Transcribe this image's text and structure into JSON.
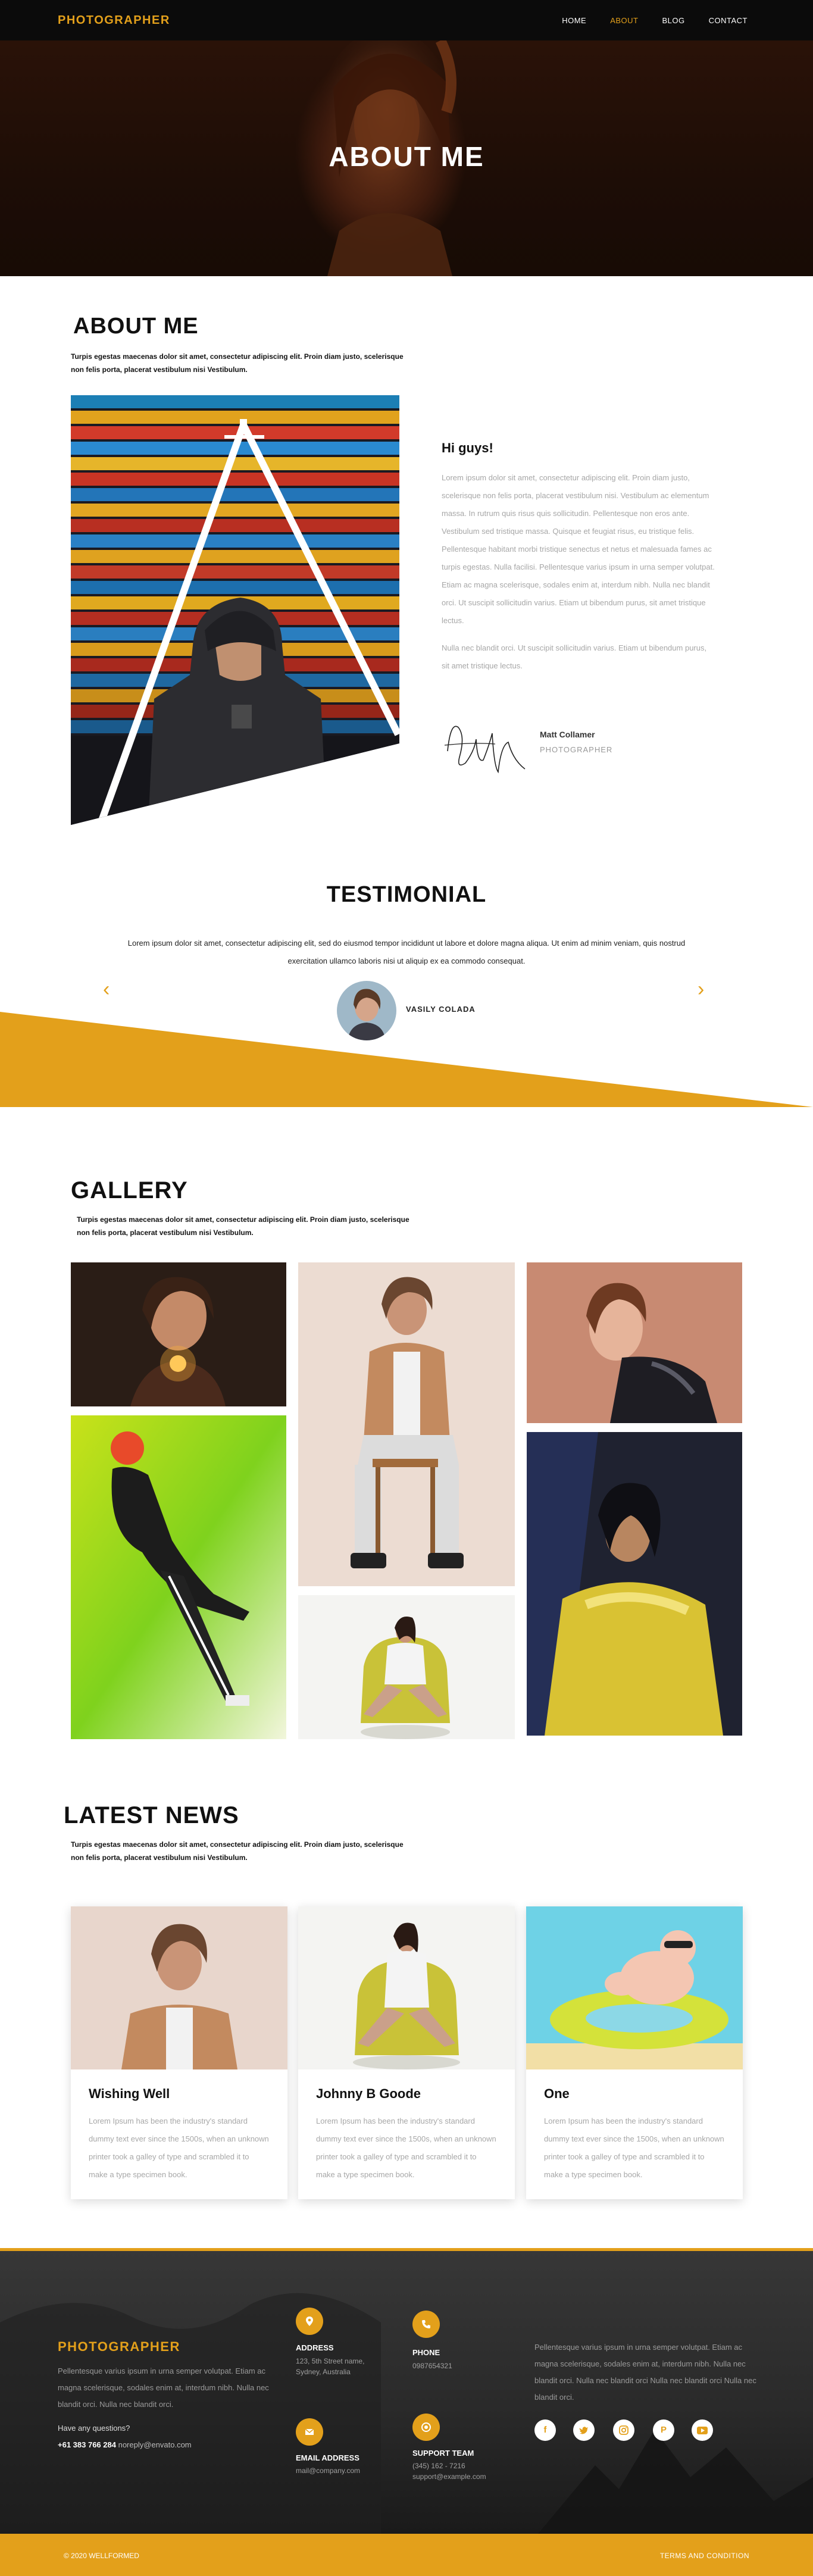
{
  "nav": {
    "logo": "PHOTOGRAPHER",
    "items": [
      "HOME",
      "ABOUT",
      "BLOG",
      "CONTACT"
    ],
    "active": "ABOUT"
  },
  "hero": {
    "title": "ABOUT ME"
  },
  "about": {
    "title": "ABOUT ME",
    "subtitle": "Turpis egestas maecenas dolor sit amet, consectetur adipiscing elit. Proin diam justo, scelerisque non felis porta, placerat vestibulum nisi Vestibulum.",
    "greeting": "Hi guys!",
    "paragraph1": "Lorem ipsum dolor sit amet, consectetur adipiscing elit. Proin diam justo, scelerisque non felis porta, placerat vestibulum nisi. Vestibulum ac elementum massa. In rutrum quis risus quis sollicitudin. Pellentesque non eros ante. Vestibulum sed tristique massa. Quisque et feugiat risus, eu tristique felis. Pellentesque habitant morbi tristique senectus et netus et malesuada fames ac turpis egestas. Nulla facilisi. Pellentesque varius ipsum in urna semper volutpat. Etiam ac magna scelerisque, sodales enim at, interdum nibh. Nulla nec blandit orci. Ut suscipit sollicitudin varius. Etiam ut bibendum purus, sit amet tristique lectus.",
    "paragraph2": "Nulla nec blandit orci. Ut suscipit sollicitudin varius. Etiam ut bibendum purus, sit amet tristique lectus.",
    "signature_name": "Matt Collamer",
    "signature_role": "PHOTOGRAPHER"
  },
  "testimonial": {
    "title": "TESTIMONIAL",
    "text": "Lorem ipsum dolor sit amet, consectetur adipiscing elit, sed do eiusmod tempor incididunt ut labore et dolore magna aliqua. Ut enim ad minim veniam, quis nostrud exercitation ullamco laboris nisi ut aliquip ex ea commodo consequat.",
    "name": "VASILY COLADA",
    "prev": "‹",
    "next": "›"
  },
  "gallery": {
    "title": "GALLERY",
    "subtitle": "Turpis egestas maecenas dolor sit amet, consectetur adipiscing elit. Proin diam justo, scelerisque non felis porta, placerat vestibulum nisi Vestibulum."
  },
  "news": {
    "title": "LATEST NEWS",
    "subtitle": "Turpis egestas maecenas dolor sit amet, consectetur adipiscing elit. Proin diam justo, scelerisque non felis porta, placerat vestibulum nisi Vestibulum.",
    "cards": [
      {
        "title": "Wishing Well",
        "text": "Lorem Ipsum has been the industry's standard dummy text ever since the 1500s, when an unknown printer took a galley of type and scrambled it to make a type specimen book."
      },
      {
        "title": "Johnny B Goode",
        "text": "Lorem Ipsum has been the industry's standard dummy text ever since the 1500s, when an unknown printer took a galley of type and scrambled it to make a type specimen book."
      },
      {
        "title": "One",
        "text": "Lorem Ipsum has been the industry's standard dummy text ever since the 1500s, when an unknown printer took a galley of type and scrambled it to make a type specimen book."
      }
    ]
  },
  "footer": {
    "logo": "PHOTOGRAPHER",
    "text": "Pellentesque varius ipsum in urna semper volutpat. Etiam ac magna scelerisque, sodales enim at, interdum nibh. Nulla nec blandit orci. Nulla nec blandit orci.",
    "question": "Have any questions?",
    "phone": "+61 383 766 284",
    "email_inline": "noreply@envato.com",
    "address_label": "ADDRESS",
    "address_value": "123, 5th Street name, Sydney, Australia",
    "phone_label": "PHONE",
    "phone_value": "0987654321",
    "email_label": "EMAIL ADDRESS",
    "email_value": "mail@company.com",
    "support_label": "SUPPORT TEAM",
    "support_value1": "(345) 162 - 7216",
    "support_value2": "support@example.com",
    "right_text": "Pellentesque varius ipsum in urna semper volutpat. Etiam ac magna scelerisque, sodales enim at, interdum nibh. Nulla nec blandit orci. Nulla nec blandit orci Nulla nec blandit orci Nulla nec blandit orci.",
    "copyright": "© 2020 WELLFORMED",
    "terms": "TERMS AND CONDITION"
  },
  "colors": {
    "accent": "#e3a01b",
    "dark": "#0b0b0b"
  }
}
